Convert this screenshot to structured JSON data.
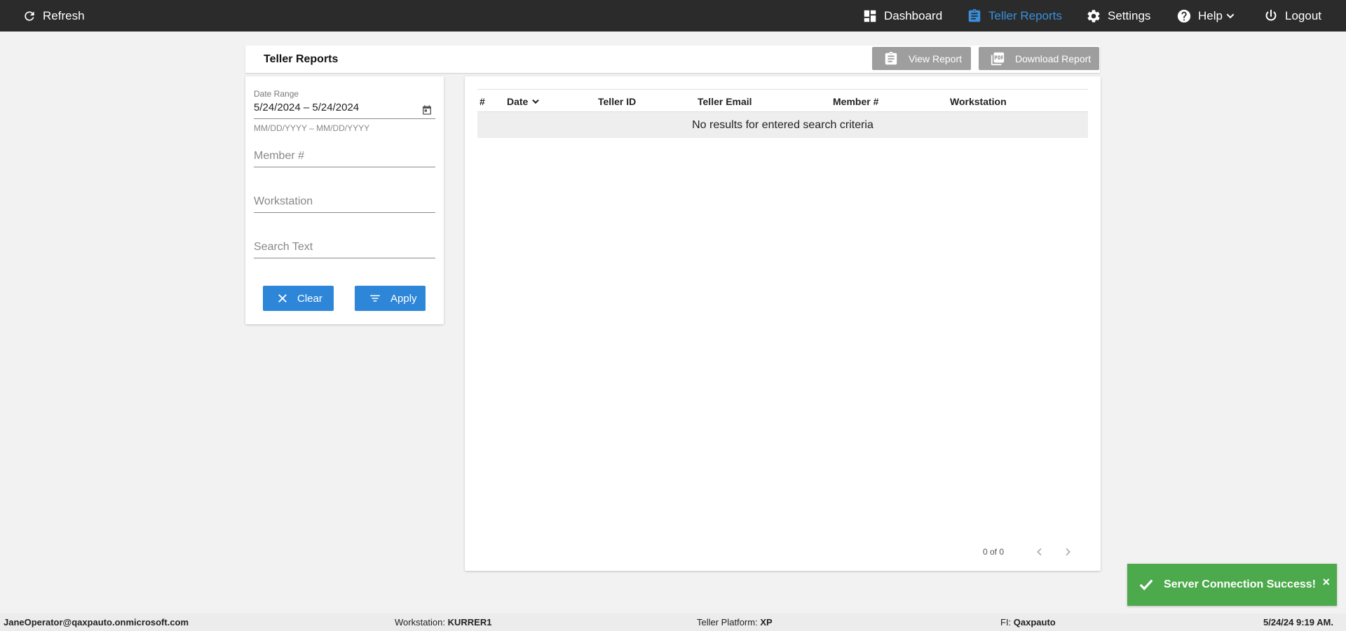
{
  "nav": {
    "refresh_label": "Refresh",
    "items": [
      {
        "label": "Dashboard",
        "icon": "dashboard-icon"
      },
      {
        "label": "Teller Reports",
        "icon": "clipboard-icon",
        "active": true
      },
      {
        "label": "Settings",
        "icon": "gear-icon"
      },
      {
        "label": "Help",
        "icon": "help-icon"
      },
      {
        "label": "Logout",
        "icon": "power-icon"
      }
    ]
  },
  "header": {
    "title": "Teller Reports",
    "view_report_label": "View Report",
    "download_report_label": "Download Report"
  },
  "filters": {
    "date_range_label": "Date Range",
    "date_range_value": "5/24/2024 – 5/24/2024",
    "date_hint": "MM/DD/YYYY – MM/DD/YYYY",
    "member_placeholder": "Member #",
    "workstation_placeholder": "Workstation",
    "search_placeholder": "Search Text",
    "clear_label": "Clear",
    "apply_label": "Apply"
  },
  "table": {
    "columns": [
      "#",
      "Date",
      "Teller ID",
      "Teller Email",
      "Member #",
      "Workstation"
    ],
    "empty_message": "No results for entered search criteria",
    "pager_text": "0 of 0"
  },
  "toast": {
    "message": "Server Connection Success!",
    "close": "×"
  },
  "status": {
    "user": "JaneOperator@qaxpauto.onmicrosoft.com",
    "workstation_label": "Workstation: ",
    "workstation_value": "KURRER1",
    "platform_label": "Teller Platform: ",
    "platform_value": "XP",
    "fi_label": "FI: ",
    "fi_value": "Qaxpauto",
    "datetime": "5/24/24 9:19 AM."
  },
  "colors": {
    "topbar": "#2b2b2b",
    "accent": "#2e86d8",
    "active_nav": "#3a8fdd",
    "toast": "#4caa4c",
    "disabled_button": "#9e9e9e"
  }
}
